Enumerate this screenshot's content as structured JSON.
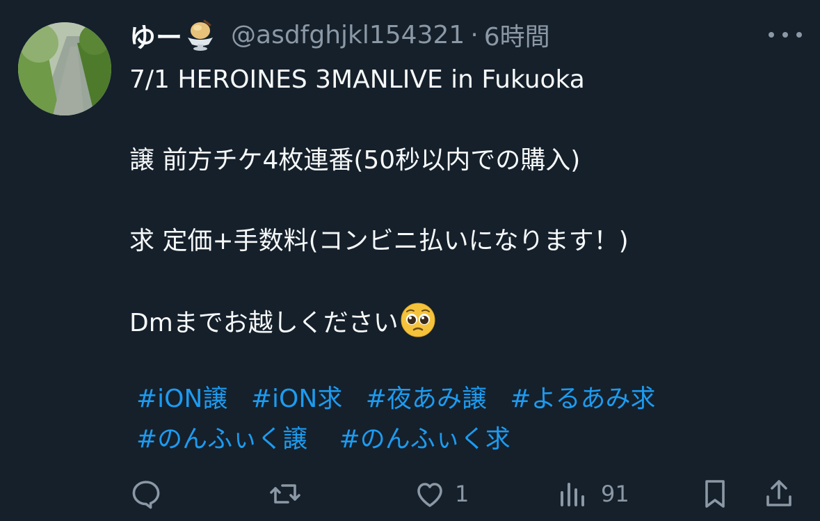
{
  "tweet": {
    "author_name": "ゆー",
    "author_emoji": "ice-cream-emoji",
    "handle": "@asdfghjkl154321",
    "separator": "·",
    "time": "6時間",
    "lines": [
      "7/1 HEROINES 3MANLIVE in Fukuoka",
      "",
      "譲 前方チケ4枚連番(50秒以内での購入)",
      "",
      "求 定価+手数料(コンビニ払いになります！)",
      "",
      "Dmまでお越しください"
    ],
    "closing_emoji": "pleading-face-emoji",
    "hashtags_row1": [
      "#iON譲",
      "#iON求",
      "#夜あみ譲",
      "#よるあみ求"
    ],
    "hashtags_row2": [
      "#のんふぃく譲",
      "#のんふぃく求"
    ]
  },
  "actions": {
    "reply_count": "",
    "retweet_count": "",
    "like_count": "1",
    "views_count": "91"
  },
  "colors": {
    "background": "#15202b",
    "text": "#f7f9f9",
    "muted": "#8b98a5",
    "link": "#1d9bf0"
  }
}
